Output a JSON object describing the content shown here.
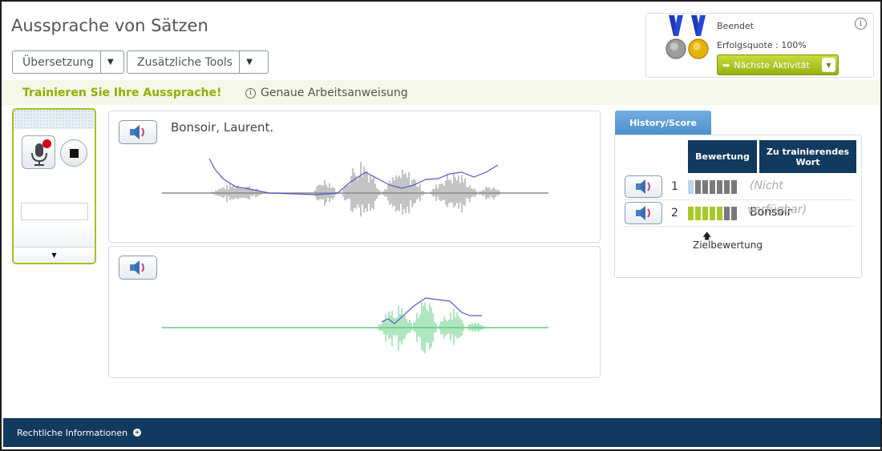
{
  "header": {
    "title": "Aussprache von Sätzen"
  },
  "toolbar": {
    "translation_label": "Übersetzung",
    "tools_label": "Zusätzliche Tools"
  },
  "status": {
    "state": "Beendet",
    "success_rate": "Erfolgsquote : 100%",
    "next_label": "Nächste Aktivität",
    "medals": [
      "silver-medal-icon",
      "gold-medal-icon"
    ]
  },
  "instructions": {
    "title": "Trainieren Sie Ihre Aussprache!",
    "link": "Genaue Arbeitsanweisung"
  },
  "model": {
    "sentence": "Bonsoir, Laurent."
  },
  "history": {
    "tab_label": "History/Score",
    "col_score": "Bewertung",
    "col_word": "Zu trainierendes Wort",
    "rows": [
      {
        "index": "1",
        "score_filled": 1,
        "score_total": 7,
        "word": "(Nicht",
        "word_overflow": "verfügbar)"
      },
      {
        "index": "2",
        "score_filled": 5,
        "score_total": 7,
        "word": "Bonsoir",
        "word_overflow": ""
      }
    ],
    "target_arrow": "🡅",
    "target_label": "Zielbewertung"
  },
  "footer": {
    "label": "Rechtliche Informationen"
  },
  "colors": {
    "model_wave": "#8a8a8a",
    "user_wave": "#5fcb7f",
    "pitch": "#5458c8",
    "score_light_blue": "#b9d7ee",
    "score_green": "#a6c92a",
    "score_gray": "#7a7a7a"
  }
}
